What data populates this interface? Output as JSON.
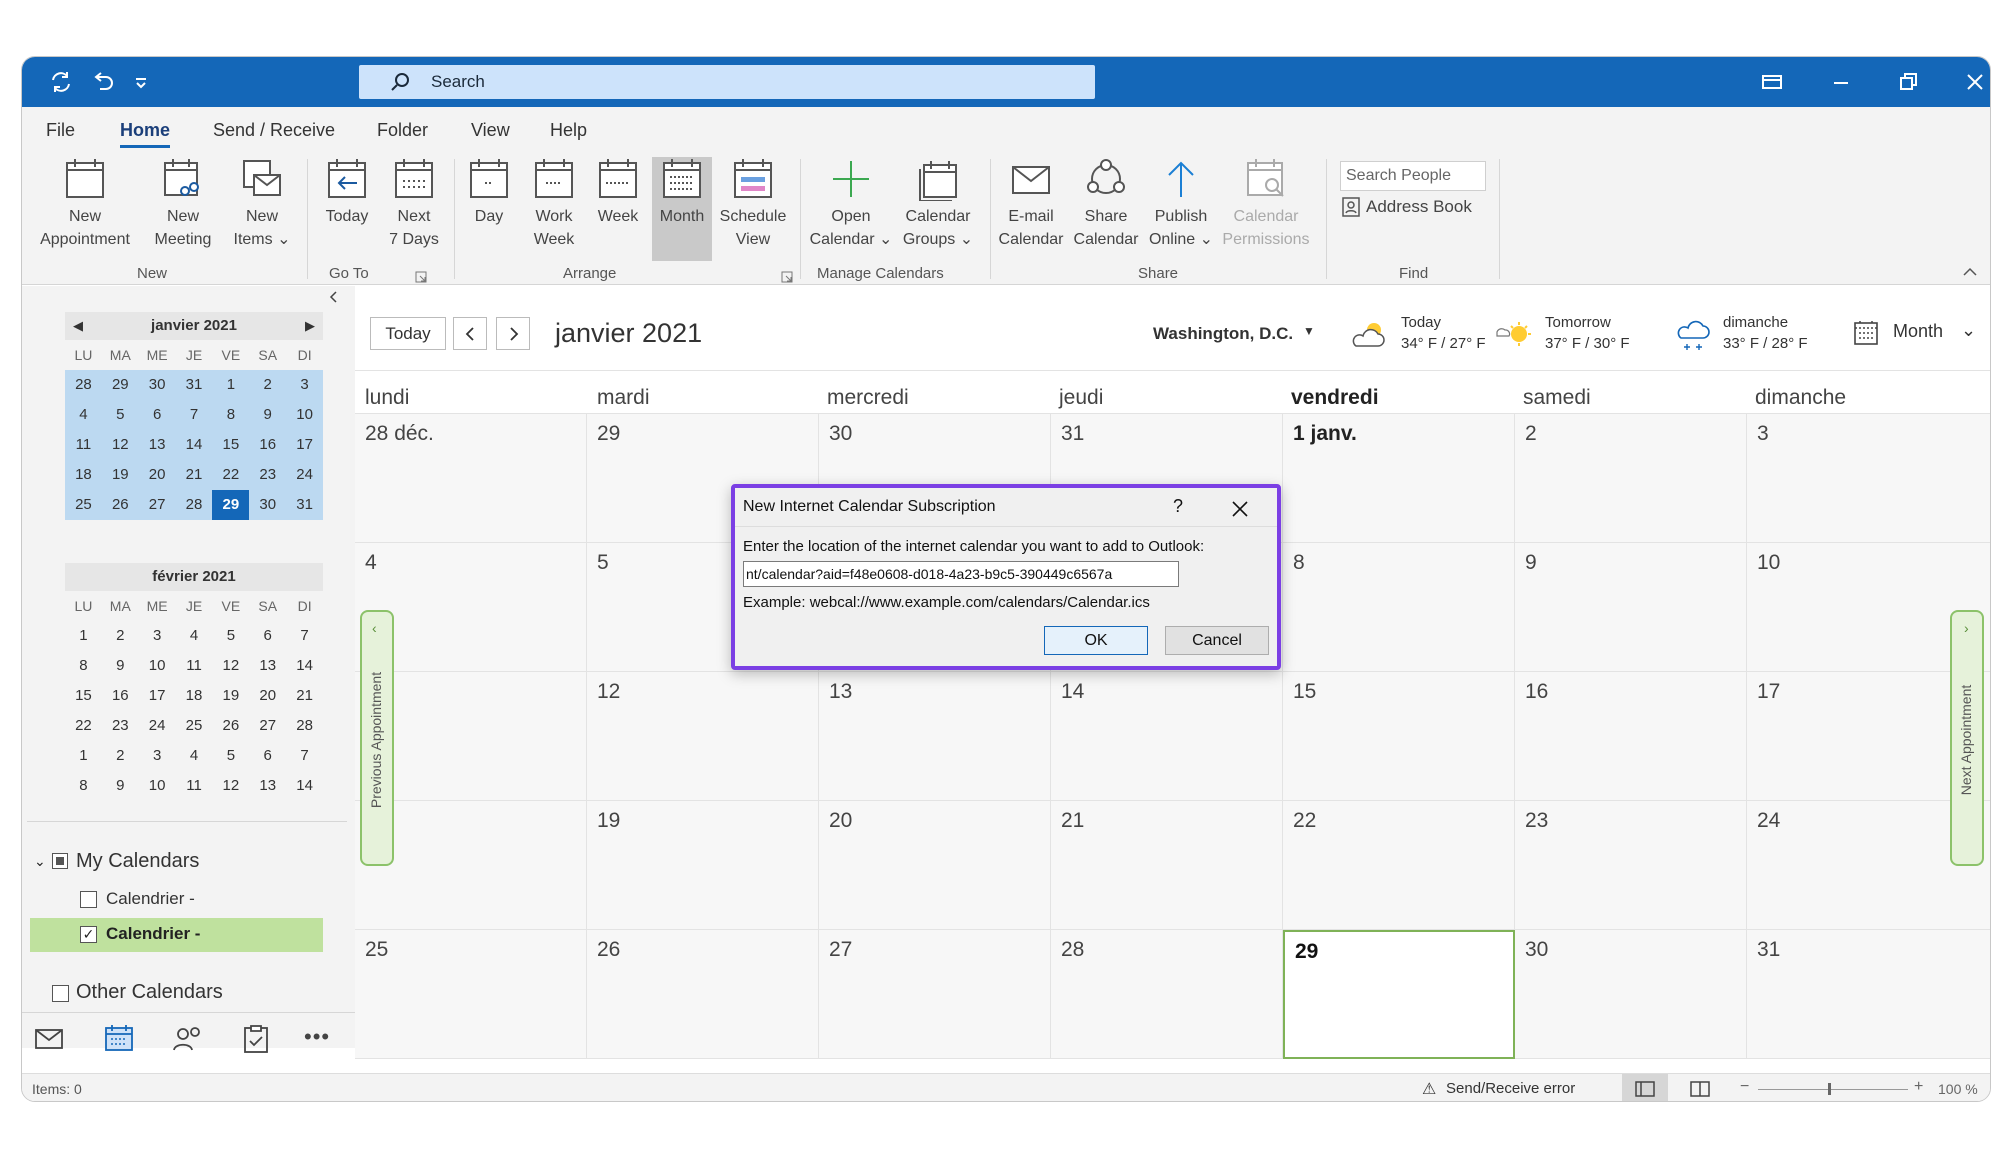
{
  "search": {
    "placeholder": "Search"
  },
  "menu_tabs": [
    "File",
    "Home",
    "Send / Receive",
    "Folder",
    "View",
    "Help"
  ],
  "ribbon": {
    "new_appointment": [
      "New",
      "Appointment"
    ],
    "new_meeting": [
      "New",
      "Meeting"
    ],
    "new_items": [
      "New",
      "Items ⌄"
    ],
    "today": [
      "Today"
    ],
    "next7": [
      "Next",
      "7 Days"
    ],
    "day": [
      "Day"
    ],
    "work_week": [
      "Work",
      "Week"
    ],
    "week": [
      "Week"
    ],
    "month": [
      "Month"
    ],
    "schedule_view": [
      "Schedule",
      "View"
    ],
    "open_calendar": [
      "Open",
      "Calendar ⌄"
    ],
    "calendar_groups": [
      "Calendar",
      "Groups ⌄"
    ],
    "email_calendar": [
      "E-mail",
      "Calendar"
    ],
    "share_calendar": [
      "Share",
      "Calendar"
    ],
    "publish_online": [
      "Publish",
      "Online ⌄"
    ],
    "calendar_permissions": [
      "Calendar",
      "Permissions"
    ],
    "search_people": "Search People",
    "address_book": "Address Book",
    "groups": [
      "New",
      "Go To",
      "Arrange",
      "Manage Calendars",
      "Share",
      "Find"
    ]
  },
  "mini_cal_jan": {
    "title": "janvier 2021",
    "dow": [
      "LU",
      "MA",
      "ME",
      "JE",
      "VE",
      "SA",
      "DI"
    ],
    "weeks": [
      [
        "28",
        "29",
        "30",
        "31",
        "1",
        "2",
        "3"
      ],
      [
        "4",
        "5",
        "6",
        "7",
        "8",
        "9",
        "10"
      ],
      [
        "11",
        "12",
        "13",
        "14",
        "15",
        "16",
        "17"
      ],
      [
        "18",
        "19",
        "20",
        "21",
        "22",
        "23",
        "24"
      ],
      [
        "25",
        "26",
        "27",
        "28",
        "29",
        "30",
        "31"
      ]
    ]
  },
  "mini_cal_feb": {
    "title": "février 2021",
    "dow": [
      "LU",
      "MA",
      "ME",
      "JE",
      "VE",
      "SA",
      "DI"
    ],
    "weeks": [
      [
        "1",
        "2",
        "3",
        "4",
        "5",
        "6",
        "7"
      ],
      [
        "8",
        "9",
        "10",
        "11",
        "12",
        "13",
        "14"
      ],
      [
        "15",
        "16",
        "17",
        "18",
        "19",
        "20",
        "21"
      ],
      [
        "22",
        "23",
        "24",
        "25",
        "26",
        "27",
        "28"
      ],
      [
        "1",
        "2",
        "3",
        "4",
        "5",
        "6",
        "7"
      ],
      [
        "8",
        "9",
        "10",
        "11",
        "12",
        "13",
        "14"
      ]
    ]
  },
  "folders": {
    "my_calendars": "My Calendars",
    "cal1": "Calendrier -",
    "cal2": "Calendrier -",
    "other_calendars": "Other Calendars"
  },
  "toolbar": {
    "today_btn": "Today",
    "month_title": "janvier 2021",
    "location": "Washington, D.C.",
    "weather": [
      {
        "label": "Today",
        "temp": "34° F / 27° F"
      },
      {
        "label": "Tomorrow",
        "temp": "37° F / 30° F"
      },
      {
        "label": "dimanche",
        "temp": "33° F / 28° F"
      }
    ],
    "view": "Month"
  },
  "calendar": {
    "days": [
      "lundi",
      "mardi",
      "mercredi",
      "jeudi",
      "vendredi",
      "samedi",
      "dimanche"
    ],
    "weeks": [
      [
        "28 déc.",
        "29",
        "30",
        "31",
        "1 janv.",
        "2",
        "3"
      ],
      [
        "4",
        "5",
        "",
        "",
        "8",
        "9",
        "10"
      ],
      [
        "",
        "12",
        "13",
        "14",
        "15",
        "16",
        "17"
      ],
      [
        "",
        "19",
        "20",
        "21",
        "22",
        "23",
        "24"
      ],
      [
        "25",
        "26",
        "27",
        "28",
        "29",
        "30",
        "31"
      ]
    ],
    "prev_appt": "Previous Appointment",
    "next_appt": "Next Appointment"
  },
  "dialog": {
    "title": "New Internet Calendar Subscription",
    "help": "?",
    "prompt": "Enter the location of the internet calendar you want to add to Outlook:",
    "value": "nt/calendar?aid=f48e0608-d018-4a23-b9c5-390449c6567a",
    "example": "Example: webcal://www.example.com/calendars/Calendar.ics",
    "ok": "OK",
    "cancel": "Cancel"
  },
  "status": {
    "items": "Items: 0",
    "error": "Send/Receive error",
    "zoom": "100 %"
  }
}
